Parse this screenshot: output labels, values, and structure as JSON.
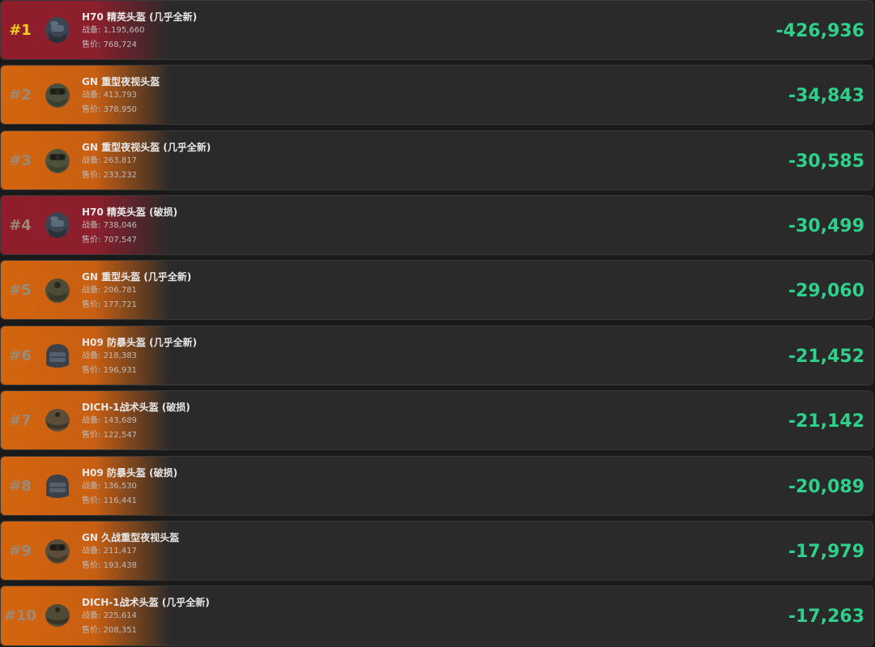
{
  "labels": {
    "gear": "战备: ",
    "price": "售价: "
  },
  "colors": {
    "red_row": "#8f1d2a",
    "orange_row": "#d4650e",
    "rank_gold": "#f4d21c",
    "value_green": "#2ed08a",
    "row_bg": "#2a2a2a"
  },
  "items": [
    {
      "rank": "#1",
      "name": "H70 精英头盔 (几乎全新)",
      "gear": "1,195,660",
      "price": "768,724",
      "value": "-426,936",
      "tier": "red",
      "icon": "helmet-icon"
    },
    {
      "rank": "#2",
      "name": "GN 重型夜视头盔",
      "gear": "413,793",
      "price": "378,950",
      "value": "-34,843",
      "tier": "orange",
      "icon": "helmet-icon"
    },
    {
      "rank": "#3",
      "name": "GN 重型夜视头盔 (几乎全新)",
      "gear": "263,817",
      "price": "233,232",
      "value": "-30,585",
      "tier": "orange",
      "icon": "helmet-icon"
    },
    {
      "rank": "#4",
      "name": "H70 精英头盔 (破损)",
      "gear": "738,046",
      "price": "707,547",
      "value": "-30,499",
      "tier": "red",
      "icon": "helmet-icon"
    },
    {
      "rank": "#5",
      "name": "GN 重型头盔 (几乎全新)",
      "gear": "206,781",
      "price": "177,721",
      "value": "-29,060",
      "tier": "orange",
      "icon": "helmet-icon"
    },
    {
      "rank": "#6",
      "name": "H09 防暴头盔 (几乎全新)",
      "gear": "218,383",
      "price": "196,931",
      "value": "-21,452",
      "tier": "orange",
      "icon": "helmet-icon"
    },
    {
      "rank": "#7",
      "name": "DICH-1战术头盔 (破损)",
      "gear": "143,689",
      "price": "122,547",
      "value": "-21,142",
      "tier": "orange",
      "icon": "helmet-icon"
    },
    {
      "rank": "#8",
      "name": "H09 防暴头盔 (破损)",
      "gear": "136,530",
      "price": "116,441",
      "value": "-20,089",
      "tier": "orange",
      "icon": "helmet-icon"
    },
    {
      "rank": "#9",
      "name": "GN 久战重型夜视头盔",
      "gear": "211,417",
      "price": "193,438",
      "value": "-17,979",
      "tier": "orange",
      "icon": "helmet-icon"
    },
    {
      "rank": "#10",
      "name": "DICH-1战术头盔 (几乎全新)",
      "gear": "225,614",
      "price": "208,351",
      "value": "-17,263",
      "tier": "orange",
      "icon": "helmet-icon"
    }
  ]
}
